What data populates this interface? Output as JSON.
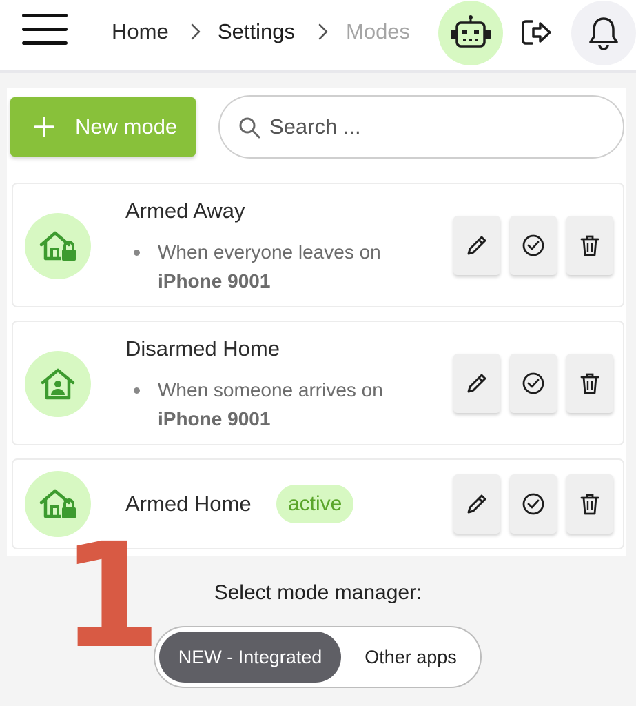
{
  "header": {
    "breadcrumb": [
      "Home",
      "Settings",
      "Modes"
    ],
    "icons": [
      "menu-icon",
      "robot-icon",
      "logout-icon",
      "bell-icon"
    ]
  },
  "toolbar": {
    "new_mode_label": "New mode",
    "search_placeholder": "Search ..."
  },
  "modes": [
    {
      "title": "Armed Away",
      "condition": "When everyone leaves on",
      "device": "iPhone 9001",
      "icon": "home-lock-icon"
    },
    {
      "title": "Disarmed Home",
      "condition": "When someone arrives on",
      "device": "iPhone 9001",
      "icon": "home-person-icon"
    },
    {
      "title": "Armed Home",
      "badge": "active",
      "icon": "home-lock-icon"
    }
  ],
  "actions": [
    "edit-icon",
    "activate-icon",
    "delete-icon"
  ],
  "annotation": "1",
  "manager": {
    "label": "Select mode manager:",
    "options": [
      "NEW - Integrated",
      "Other apps"
    ],
    "selected": "NEW - Integrated"
  },
  "colors": {
    "accent_green": "#88c13a",
    "icon_green": "#3d9b2f",
    "soft_green": "#d7f8c2",
    "annotation_red": "#d85a44"
  }
}
